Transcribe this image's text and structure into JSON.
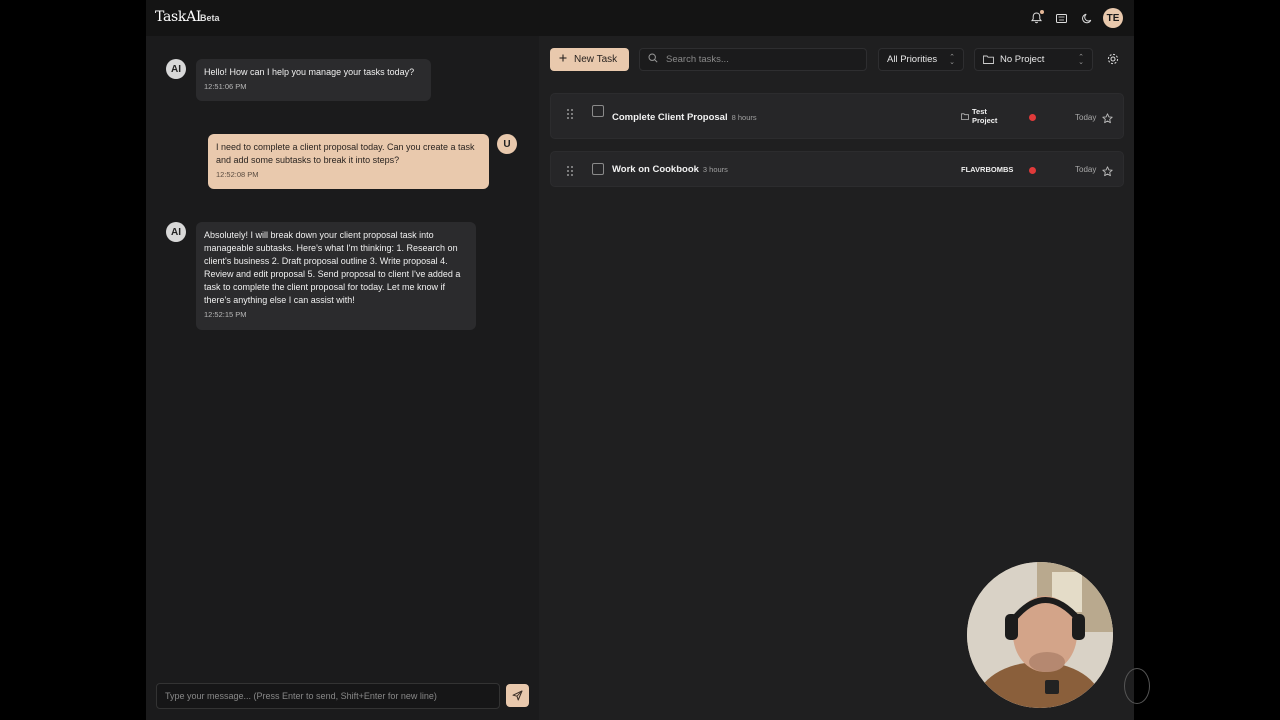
{
  "header": {
    "logo": "TaskAI",
    "beta": "Beta",
    "user_initials": "TE",
    "icons": [
      "bell-icon",
      "keyboard-icon",
      "moon-icon"
    ]
  },
  "chat": {
    "messages": [
      {
        "role": "ai",
        "avatar": "AI",
        "text": "Hello! How can I help you manage your tasks today?",
        "time": "12:51:06 PM"
      },
      {
        "role": "user",
        "avatar": "U",
        "text": "I need to complete a client proposal today. Can you create a task and add some subtasks to break it into steps?",
        "time": "12:52:08 PM"
      },
      {
        "role": "ai",
        "avatar": "AI",
        "text": "Absolutely! I will break down your client proposal task into manageable subtasks. Here's what I'm thinking: 1. Research on client's business 2. Draft proposal outline 3. Write proposal 4. Review and edit proposal 5. Send proposal to client I've added a task to complete the client proposal for today. Let me know if there's anything else I can assist with!",
        "time": "12:52:15 PM"
      }
    ],
    "composer_placeholder": "Type your message... (Press Enter to send, Shift+Enter for new line)"
  },
  "toolbar": {
    "new_task_label": "New Task",
    "search_placeholder": "Search tasks...",
    "priority_filter": "All Priorities",
    "project_filter": "No Project"
  },
  "tasks": [
    {
      "title": "Complete Client Proposal",
      "duration": "8 hours",
      "project": "Test Project",
      "priority_color": "#e03a3a",
      "due": "Today"
    },
    {
      "title": "Work on Cookbook",
      "duration": "3 hours",
      "project": "FLAVRBOMBS",
      "priority_color": "#e03a3a",
      "due": "Today"
    }
  ],
  "colors": {
    "accent": "#e9c9ad",
    "priority_high": "#e03a3a",
    "background": "#1b1b1c"
  }
}
